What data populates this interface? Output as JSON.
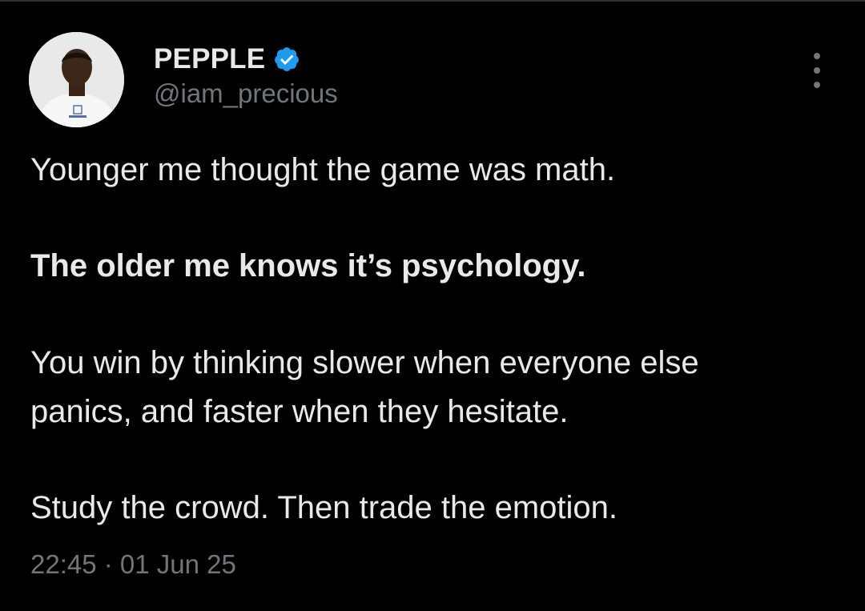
{
  "author": {
    "display_name": "PEPPLE",
    "handle": "@iam_precious",
    "verified": true,
    "verified_color": "#1d9bf0"
  },
  "avatar": {
    "icon": "profile-photo"
  },
  "more_menu": {
    "icon": "more-vertical-icon"
  },
  "tweet": {
    "line1": "Younger me thought the game was math.",
    "line2": "The older me knows it’s psychology.",
    "line3a": "You win by thinking slower when everyone else",
    "line3b": "panics, and faster when they hesitate.",
    "line4": "Study the crowd. Then trade the emotion."
  },
  "meta": {
    "timestamp": "22:45 · 01 Jun 25"
  },
  "colors": {
    "background": "#000000",
    "text_primary": "#e7e9ea",
    "text_secondary": "#71767b"
  }
}
